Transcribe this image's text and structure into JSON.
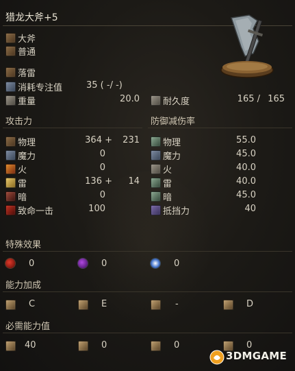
{
  "weapon": {
    "name": "猎龙大斧+5",
    "type": "大斧",
    "attack_type": "普通",
    "skill": "落雷",
    "fp_cost_label": "消耗专注值",
    "fp_cost_value": "35 (  -/  -)",
    "weight_label": "重量",
    "weight_value": "20.0",
    "durability_label": "耐久度",
    "durability_value": "165 /",
    "durability_max": "165"
  },
  "attack": {
    "header": "攻击力",
    "rows": [
      {
        "label": "物理",
        "base": "364 +",
        "bonus": "231",
        "icon": "physical-attack-icon"
      },
      {
        "label": "魔力",
        "base": "0",
        "bonus": "",
        "icon": "magic-attack-icon"
      },
      {
        "label": "火",
        "base": "0",
        "bonus": "",
        "icon": "fire-attack-icon"
      },
      {
        "label": "雷",
        "base": "136 +",
        "bonus": "14",
        "icon": "lightning-attack-icon"
      },
      {
        "label": "暗",
        "base": "0",
        "bonus": "",
        "icon": "dark-attack-icon"
      },
      {
        "label": "致命一击",
        "base": "100",
        "bonus": "",
        "icon": "critical-icon"
      }
    ]
  },
  "defense": {
    "header": "防御减伤率",
    "rows": [
      {
        "label": "物理",
        "value": "55.0",
        "icon": "physical-defense-icon"
      },
      {
        "label": "魔力",
        "value": "45.0",
        "icon": "magic-defense-icon"
      },
      {
        "label": "火",
        "value": "40.0",
        "icon": "fire-defense-icon"
      },
      {
        "label": "雷",
        "value": "40.0",
        "icon": "lightning-defense-icon"
      },
      {
        "label": "暗",
        "value": "45.0",
        "icon": "dark-defense-icon"
      },
      {
        "label": "抵挡力",
        "value": "40",
        "icon": "stability-icon"
      }
    ]
  },
  "special_effects": {
    "header": "特殊效果",
    "values": [
      "0",
      "0",
      "0"
    ],
    "icons": [
      "bleed-icon",
      "poison-icon",
      "frost-icon"
    ]
  },
  "scaling": {
    "header": "能力加成",
    "values": [
      "C",
      "E",
      "-",
      "D"
    ],
    "icons": [
      "strength-icon",
      "dexterity-icon",
      "intelligence-icon",
      "faith-icon"
    ]
  },
  "requirements": {
    "header": "必需能力值",
    "values": [
      "40",
      "0",
      "0",
      "0"
    ],
    "icons": [
      "strength-icon",
      "dexterity-icon",
      "intelligence-icon",
      "faith-icon"
    ]
  },
  "watermark": {
    "text": "3DMGAME"
  },
  "colors": {
    "background": "#1c1a16",
    "text": "#d9d3c4",
    "divider": "#4a4437"
  }
}
